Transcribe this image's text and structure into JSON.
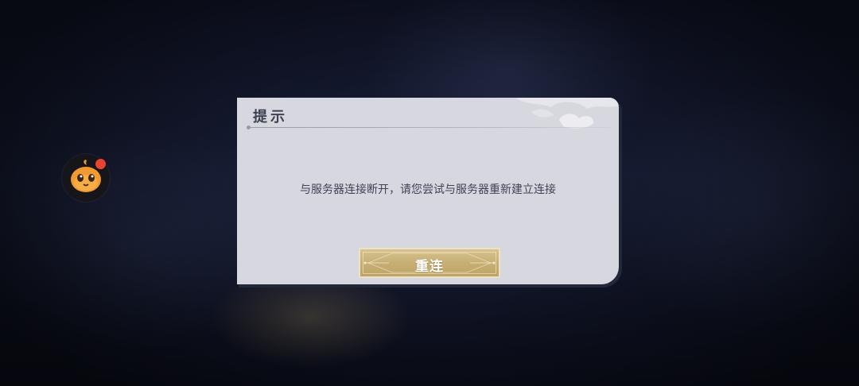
{
  "dialog": {
    "title": "提示",
    "message": "与服务器连接断开，请您尝试与服务器重新建立连接",
    "reconnect_label": "重连"
  },
  "floating_assistant": {
    "icon": "orange-mascot-icon",
    "has_notification": true
  },
  "colors": {
    "dialog_bg": "#d7d7df",
    "button_gold": "#c7af74",
    "notification_red": "#e8432f",
    "mascot_orange": "#f29a2e"
  }
}
